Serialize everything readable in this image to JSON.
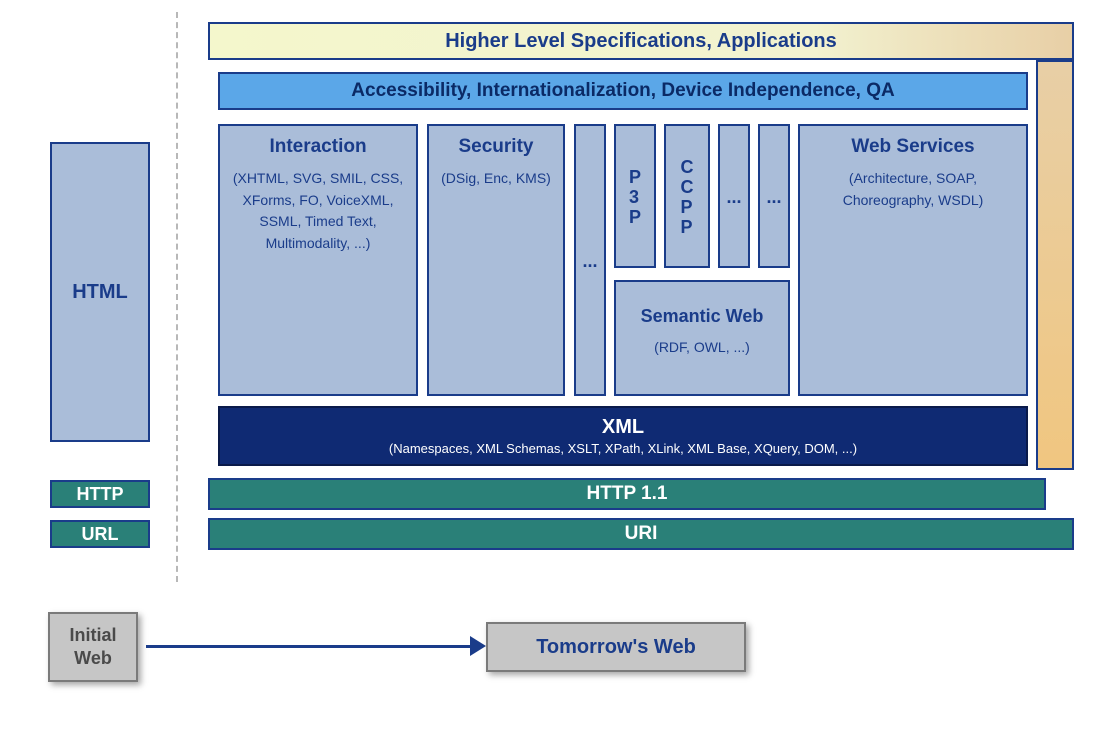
{
  "top_bar": "Higher Level Specifications, Applications",
  "accessibility_bar": "Accessibility, Internationalization, Device Independence, QA",
  "left": {
    "html": "HTML",
    "http": "HTTP",
    "url": "URL"
  },
  "stacks": {
    "interaction": {
      "title": "Interaction",
      "sub": "(XHTML, SVG, SMIL, CSS, XForms, FO, VoiceXML, SSML, Timed Text, Multimodality, ...)"
    },
    "security": {
      "title": "Security",
      "sub": "(DSig, Enc, KMS)"
    },
    "dots": "...",
    "p3p": "P3P",
    "ccpp": "CCPP",
    "semantic_web": {
      "title": "Semantic Web",
      "sub": "(RDF, OWL, ...)"
    },
    "web_services": {
      "title": "Web Services",
      "sub": "(Architecture, SOAP, Choreography, WSDL)"
    }
  },
  "xml": {
    "title": "XML",
    "sub": "(Namespaces, XML Schemas, XSLT, XPath, XLink, XML Base, XQuery, DOM, ...)"
  },
  "http11": "HTTP 1.1",
  "uri": "URI",
  "legend": {
    "initial": "Initial Web",
    "tomorrow": "Tomorrow's Web"
  },
  "colors": {
    "lightblue": "#aabdd9",
    "brightblue": "#5ba7e8",
    "navy": "#0f2a73",
    "teal": "#2a8078",
    "yellow": "#f4f7cc",
    "orange": "#f0c680",
    "grey": "#c6c6c6",
    "bluetext": "#1a3c8a"
  }
}
